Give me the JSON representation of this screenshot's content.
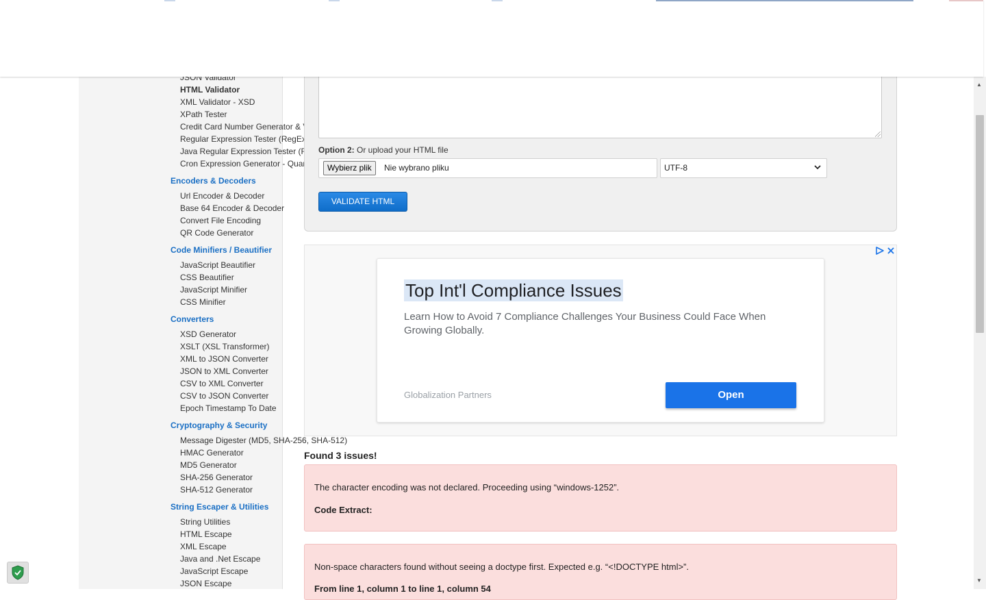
{
  "sidebar": {
    "groups": [
      {
        "category": "",
        "items": [
          "JSON Validator",
          "HTML Validator",
          "XML Validator - XSD",
          "XPath Tester",
          "Credit Card Number Generator & Validator",
          "Regular Expression Tester (RegEx)",
          "Java Regular Expression Tester (RegEx)",
          "Cron Expression Generator - Quartz"
        ]
      },
      {
        "category": "Encoders & Decoders",
        "items": [
          "Url Encoder & Decoder",
          "Base 64 Encoder & Decoder",
          "Convert File Encoding",
          "QR Code Generator"
        ]
      },
      {
        "category": "Code Minifiers / Beautifier",
        "items": [
          "JavaScript Beautifier",
          "CSS Beautifier",
          "JavaScript Minifier",
          "CSS Minifier"
        ]
      },
      {
        "category": "Converters",
        "items": [
          "XSD Generator",
          "XSLT (XSL Transformer)",
          "XML to JSON Converter",
          "JSON to XML Converter",
          "CSV to XML Converter",
          "CSV to JSON Converter",
          "Epoch Timestamp To Date"
        ]
      },
      {
        "category": "Cryptography & Security",
        "items": [
          "Message Digester (MD5, SHA-256, SHA-512)",
          "HMAC Generator",
          "MD5 Generator",
          "SHA-256 Generator",
          "SHA-512 Generator"
        ]
      },
      {
        "category": "String Escaper & Utilities",
        "items": [
          "String Utilities",
          "HTML Escape",
          "XML Escape",
          "Java and .Net Escape",
          "JavaScript Escape",
          "JSON Escape"
        ]
      }
    ],
    "active_item": "HTML Validator"
  },
  "form": {
    "option2_label": "Option 2:",
    "option2_text": " Or upload your HTML file",
    "file_button_label": "Wybierz plik",
    "file_status": "Nie wybrano pliku",
    "encoding_selected": "UTF-8",
    "validate_label": "VALIDATE HTML"
  },
  "ad": {
    "title": "Top Int'l Compliance Issues",
    "description": "Learn How to Avoid 7 Compliance Challenges Your Business Could Face When Growing Globally.",
    "brand": "Globalization Partners",
    "cta": "Open"
  },
  "results": {
    "summary": "Found 3 issues!",
    "issues": [
      {
        "message": "The character encoding was not declared. Proceeding using “windows-1252”.",
        "sub": "Code Extract:"
      },
      {
        "message": "Non-space characters found without seeing a doctype first. Expected e.g. “<!DOCTYPE html>”.",
        "sub": "From line 1, column 1 to line 1, column 54"
      }
    ]
  },
  "colors": {
    "accent": "#1a6fc4",
    "validate_button": "#0f6dc9",
    "ad_button": "#1a73e8",
    "issue_bg": "#fbdedd"
  }
}
